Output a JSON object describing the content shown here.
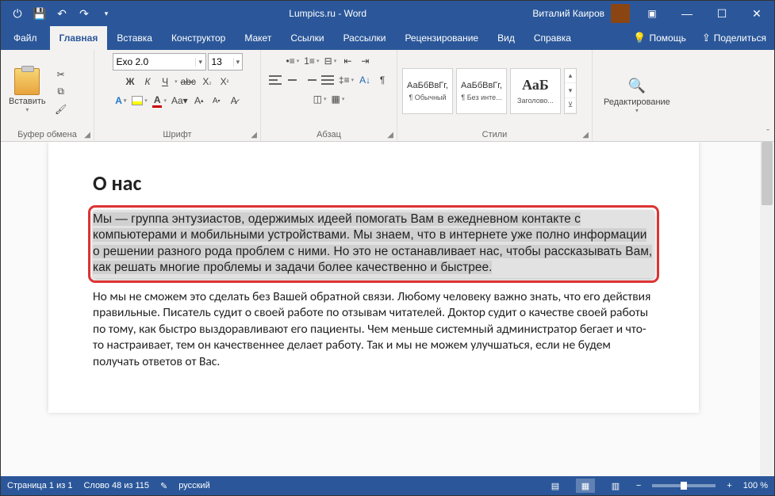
{
  "titlebar": {
    "app_title": "Lumpics.ru - Word",
    "user_name": "Виталий Каиров"
  },
  "tabs": {
    "file": "Файл",
    "home": "Главная",
    "insert": "Вставка",
    "design": "Конструктор",
    "layout": "Макет",
    "references": "Ссылки",
    "mailings": "Рассылки",
    "review": "Рецензирование",
    "view": "Вид",
    "help": "Справка",
    "tell_me": "Помощь",
    "share": "Поделиться"
  },
  "ribbon": {
    "clipboard": {
      "label": "Буфер обмена",
      "paste": "Вставить"
    },
    "font": {
      "label": "Шрифт",
      "font_name": "Exo 2.0",
      "font_size": "13"
    },
    "paragraph": {
      "label": "Абзац"
    },
    "styles": {
      "label": "Стили",
      "preview_text": "АаБбВвГг,",
      "items": [
        {
          "name": "¶ Обычный"
        },
        {
          "name": "¶ Без инте..."
        },
        {
          "name": "Заголово..."
        }
      ],
      "heading_preview": "АаБ"
    },
    "editing": {
      "label": "Редактирование"
    }
  },
  "document": {
    "heading": "О нас",
    "para1": "Мы — группа энтузиастов, одержимых идеей помогать Вам в ежедневном контакте с компьютерами и мобильными устройствами. Мы знаем, что в интернете уже полно информации о решении разного рода проблем с ними. Но это не останавливает нас, чтобы рассказывать Вам, как решать многие проблемы и задачи более качественно и быстрее.",
    "para2": "Но мы не сможем это сделать без Вашей обратной связи. Любому человеку важно знать, что его действия правильные. Писатель судит о своей работе по отзывам читателей. Доктор судит о качестве своей работы по тому, как быстро выздоравливают его пациенты. Чем меньше системный администратор бегает и что-то настраивает, тем он качественнее делает работу. Так и мы не можем улучшаться, если не будем получать ответов от Вас."
  },
  "statusbar": {
    "page": "Страница 1 из 1",
    "words": "Слово 48 из 115",
    "language": "русский",
    "zoom": "100 %"
  }
}
